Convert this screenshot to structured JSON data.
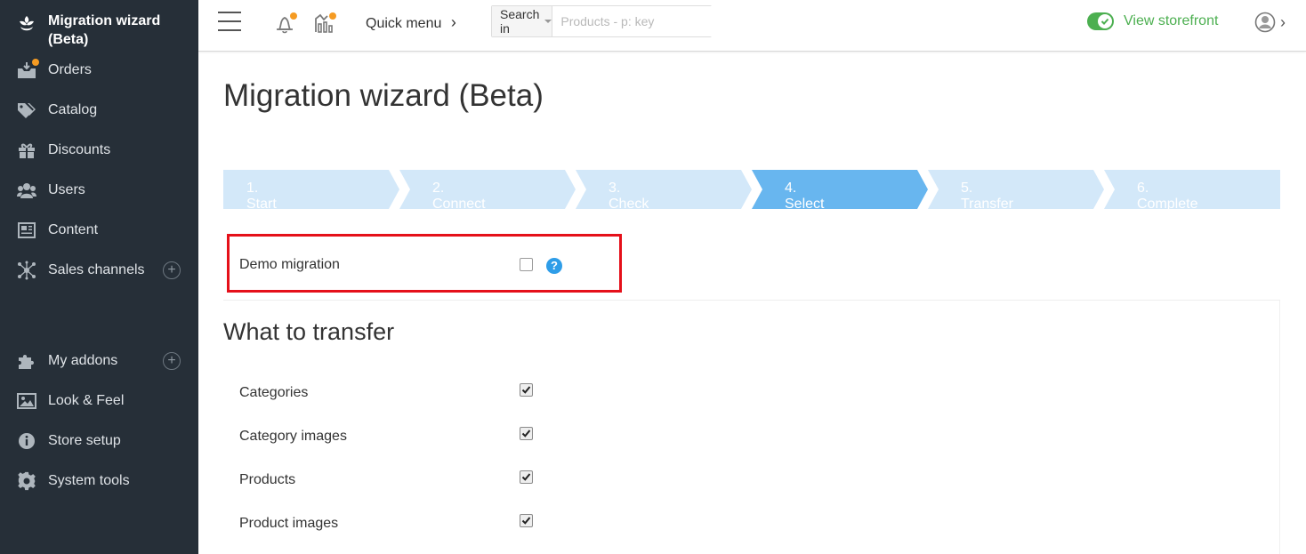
{
  "sidebar": {
    "header_title": "Migration wizard (Beta)",
    "items": [
      {
        "label": "Orders",
        "icon": "orders-icon"
      },
      {
        "label": "Catalog",
        "icon": "tag-icon"
      },
      {
        "label": "Discounts",
        "icon": "gift-icon"
      },
      {
        "label": "Users",
        "icon": "users-icon"
      },
      {
        "label": "Content",
        "icon": "newspaper-icon"
      },
      {
        "label": "Sales channels",
        "icon": "network-icon"
      },
      {
        "label": "My addons",
        "icon": "puzzle-icon"
      },
      {
        "label": "Look & Feel",
        "icon": "image-icon"
      },
      {
        "label": "Store setup",
        "icon": "info-icon"
      },
      {
        "label": "System tools",
        "icon": "gear-icon"
      }
    ],
    "add_symbol": "+"
  },
  "topbar": {
    "quick_menu": "Quick menu",
    "quick_menu_chevron": "›",
    "search_in": "Search in",
    "search_placeholder": "Products - p: key",
    "view_storefront": "View storefront",
    "user_chevron": "›"
  },
  "page": {
    "title": "Migration wizard (Beta)",
    "steps": [
      {
        "label": "1. Start",
        "state": "done"
      },
      {
        "label": "2. Connect",
        "state": "done"
      },
      {
        "label": "3. Check",
        "state": "done"
      },
      {
        "label": "4. Select",
        "state": "active"
      },
      {
        "label": "5. Transfer",
        "state": "pending"
      },
      {
        "label": "6. Complete",
        "state": "pending"
      }
    ],
    "demo_migration": {
      "label": "Demo migration",
      "checked": false,
      "help": "?"
    },
    "what_to_transfer_title": "What to transfer",
    "transfer_items": [
      {
        "label": "Categories",
        "checked": true
      },
      {
        "label": "Category images",
        "checked": true
      },
      {
        "label": "Products",
        "checked": true
      },
      {
        "label": "Product images",
        "checked": true
      }
    ]
  },
  "colors": {
    "sidebar_bg": "#262f38",
    "step_active": "#68b6ef",
    "step_inactive": "#d3e8f9",
    "storefront_green": "#4caf50",
    "highlight_red": "#e5101a",
    "notification_dot": "#f59b23"
  }
}
